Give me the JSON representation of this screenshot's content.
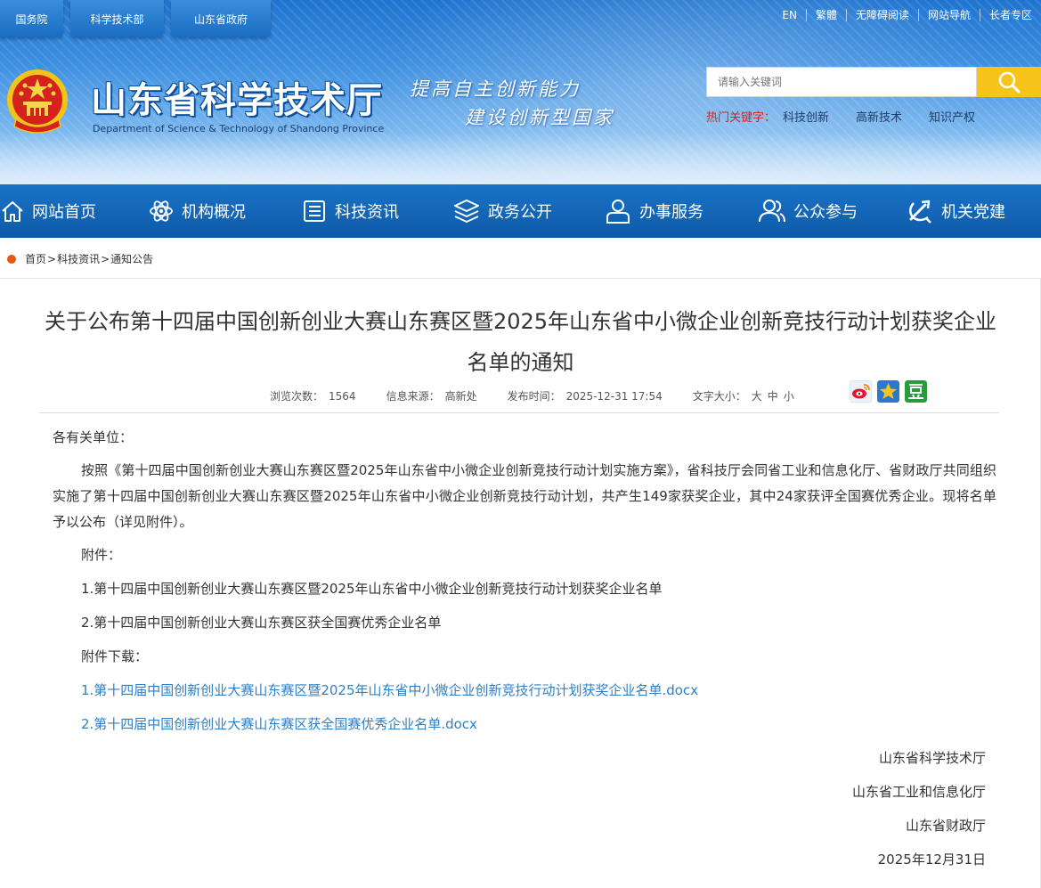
{
  "header": {
    "top_links": [
      "国务院",
      "科学技术部",
      "山东省政府"
    ],
    "utility_links": [
      "EN",
      "繁體",
      "无障碍阅读",
      "网站导航",
      "长者专区"
    ],
    "site_title": "山东省科学技术厅",
    "site_title_en": "Department of Science & Technology of Shandong Province",
    "slogan_line1": "提高自主创新能力",
    "slogan_line2": "建设创新型国家",
    "search": {
      "placeholder": "请输入关键词",
      "hot_label": "热门关键字：",
      "hot_words": [
        "科技创新",
        "高新技术",
        "知识产权"
      ]
    }
  },
  "nav": {
    "items": [
      "网站首页",
      "机构概况",
      "科技资讯",
      "政务公开",
      "办事服务",
      "公众参与",
      "机关党建"
    ]
  },
  "breadcrumb": {
    "items": [
      "首页",
      "科技资讯",
      "通知公告"
    ],
    "separator": ">"
  },
  "article": {
    "title": "关于公布第十四届中国创新创业大赛山东赛区暨2025年山东省中小微企业创新竞技行动计划获奖企业名单的通知",
    "meta": {
      "views_label": "浏览次数：",
      "views": "1564",
      "source_label": "信息来源：",
      "source": "高新处",
      "time_label": "发布时间：",
      "time": "2025-12-31 17:54",
      "font_label": "文字大小：",
      "font_sizes": [
        "大",
        "中",
        "小"
      ]
    },
    "greeting": "各有关单位：",
    "body": "按照《第十四届中国创新创业大赛山东赛区暨2025年山东省中小微企业创新竞技行动计划实施方案》，省科技厅会同省工业和信息化厅、省财政厅共同组织实施了第十四届中国创新创业大赛山东赛区暨2025年山东省中小微企业创新竞技行动计划，共产生149家获奖企业，其中24家获评全国赛优秀企业。现将名单予以公布（详见附件）。",
    "attachment_label": "附件：",
    "attachments": [
      "1.第十四届中国创新创业大赛山东赛区暨2025年山东省中小微企业创新竞技行动计划获奖企业名单",
      "2.第十四届中国创新创业大赛山东赛区获全国赛优秀企业名单"
    ],
    "download_label": "附件下载：",
    "downloads": [
      "1.第十四届中国创新创业大赛山东赛区暨2025年山东省中小微企业创新竞技行动计划获奖企业名单.docx",
      "2.第十四届中国创新创业大赛山东赛区获全国赛优秀企业名单.docx"
    ],
    "signatures": [
      "山东省科学技术厅",
      "山东省工业和信息化厅",
      "山东省财政厅",
      "2025年12月31日"
    ]
  },
  "share_icons": [
    "weibo-icon",
    "qzone-icon",
    "douban-icon"
  ],
  "colors": {
    "nav_blue": "#0d5aa8",
    "search_yellow": "#f7c41b",
    "hot_red": "#d8221c",
    "link_blue": "#2f7fc6",
    "breadcrumb_dot": "#e8550f"
  }
}
